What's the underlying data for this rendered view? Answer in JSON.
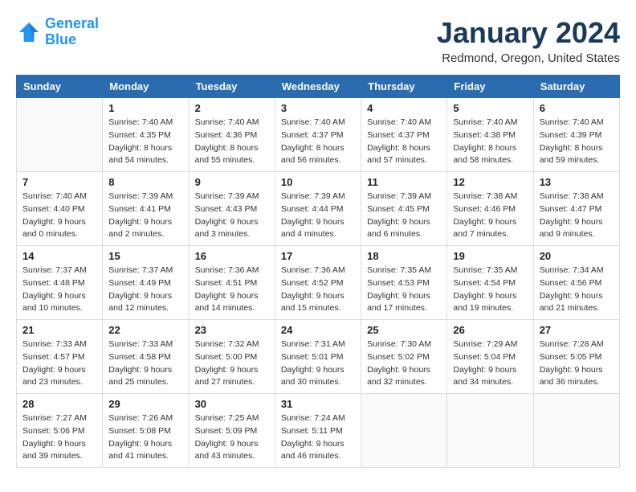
{
  "header": {
    "logo_line1": "General",
    "logo_line2": "Blue",
    "title": "January 2024",
    "subtitle": "Redmond, Oregon, United States"
  },
  "weekdays": [
    "Sunday",
    "Monday",
    "Tuesday",
    "Wednesday",
    "Thursday",
    "Friday",
    "Saturday"
  ],
  "weeks": [
    [
      {
        "day": "",
        "info": ""
      },
      {
        "day": "1",
        "info": "Sunrise: 7:40 AM\nSunset: 4:35 PM\nDaylight: 8 hours\nand 54 minutes."
      },
      {
        "day": "2",
        "info": "Sunrise: 7:40 AM\nSunset: 4:36 PM\nDaylight: 8 hours\nand 55 minutes."
      },
      {
        "day": "3",
        "info": "Sunrise: 7:40 AM\nSunset: 4:37 PM\nDaylight: 8 hours\nand 56 minutes."
      },
      {
        "day": "4",
        "info": "Sunrise: 7:40 AM\nSunset: 4:37 PM\nDaylight: 8 hours\nand 57 minutes."
      },
      {
        "day": "5",
        "info": "Sunrise: 7:40 AM\nSunset: 4:38 PM\nDaylight: 8 hours\nand 58 minutes."
      },
      {
        "day": "6",
        "info": "Sunrise: 7:40 AM\nSunset: 4:39 PM\nDaylight: 8 hours\nand 59 minutes."
      }
    ],
    [
      {
        "day": "7",
        "info": "Sunrise: 7:40 AM\nSunset: 4:40 PM\nDaylight: 9 hours\nand 0 minutes."
      },
      {
        "day": "8",
        "info": "Sunrise: 7:39 AM\nSunset: 4:41 PM\nDaylight: 9 hours\nand 2 minutes."
      },
      {
        "day": "9",
        "info": "Sunrise: 7:39 AM\nSunset: 4:43 PM\nDaylight: 9 hours\nand 3 minutes."
      },
      {
        "day": "10",
        "info": "Sunrise: 7:39 AM\nSunset: 4:44 PM\nDaylight: 9 hours\nand 4 minutes."
      },
      {
        "day": "11",
        "info": "Sunrise: 7:39 AM\nSunset: 4:45 PM\nDaylight: 9 hours\nand 6 minutes."
      },
      {
        "day": "12",
        "info": "Sunrise: 7:38 AM\nSunset: 4:46 PM\nDaylight: 9 hours\nand 7 minutes."
      },
      {
        "day": "13",
        "info": "Sunrise: 7:38 AM\nSunset: 4:47 PM\nDaylight: 9 hours\nand 9 minutes."
      }
    ],
    [
      {
        "day": "14",
        "info": "Sunrise: 7:37 AM\nSunset: 4:48 PM\nDaylight: 9 hours\nand 10 minutes."
      },
      {
        "day": "15",
        "info": "Sunrise: 7:37 AM\nSunset: 4:49 PM\nDaylight: 9 hours\nand 12 minutes."
      },
      {
        "day": "16",
        "info": "Sunrise: 7:36 AM\nSunset: 4:51 PM\nDaylight: 9 hours\nand 14 minutes."
      },
      {
        "day": "17",
        "info": "Sunrise: 7:36 AM\nSunset: 4:52 PM\nDaylight: 9 hours\nand 15 minutes."
      },
      {
        "day": "18",
        "info": "Sunrise: 7:35 AM\nSunset: 4:53 PM\nDaylight: 9 hours\nand 17 minutes."
      },
      {
        "day": "19",
        "info": "Sunrise: 7:35 AM\nSunset: 4:54 PM\nDaylight: 9 hours\nand 19 minutes."
      },
      {
        "day": "20",
        "info": "Sunrise: 7:34 AM\nSunset: 4:56 PM\nDaylight: 9 hours\nand 21 minutes."
      }
    ],
    [
      {
        "day": "21",
        "info": "Sunrise: 7:33 AM\nSunset: 4:57 PM\nDaylight: 9 hours\nand 23 minutes."
      },
      {
        "day": "22",
        "info": "Sunrise: 7:33 AM\nSunset: 4:58 PM\nDaylight: 9 hours\nand 25 minutes."
      },
      {
        "day": "23",
        "info": "Sunrise: 7:32 AM\nSunset: 5:00 PM\nDaylight: 9 hours\nand 27 minutes."
      },
      {
        "day": "24",
        "info": "Sunrise: 7:31 AM\nSunset: 5:01 PM\nDaylight: 9 hours\nand 30 minutes."
      },
      {
        "day": "25",
        "info": "Sunrise: 7:30 AM\nSunset: 5:02 PM\nDaylight: 9 hours\nand 32 minutes."
      },
      {
        "day": "26",
        "info": "Sunrise: 7:29 AM\nSunset: 5:04 PM\nDaylight: 9 hours\nand 34 minutes."
      },
      {
        "day": "27",
        "info": "Sunrise: 7:28 AM\nSunset: 5:05 PM\nDaylight: 9 hours\nand 36 minutes."
      }
    ],
    [
      {
        "day": "28",
        "info": "Sunrise: 7:27 AM\nSunset: 5:06 PM\nDaylight: 9 hours\nand 39 minutes."
      },
      {
        "day": "29",
        "info": "Sunrise: 7:26 AM\nSunset: 5:08 PM\nDaylight: 9 hours\nand 41 minutes."
      },
      {
        "day": "30",
        "info": "Sunrise: 7:25 AM\nSunset: 5:09 PM\nDaylight: 9 hours\nand 43 minutes."
      },
      {
        "day": "31",
        "info": "Sunrise: 7:24 AM\nSunset: 5:11 PM\nDaylight: 9 hours\nand 46 minutes."
      },
      {
        "day": "",
        "info": ""
      },
      {
        "day": "",
        "info": ""
      },
      {
        "day": "",
        "info": ""
      }
    ]
  ]
}
